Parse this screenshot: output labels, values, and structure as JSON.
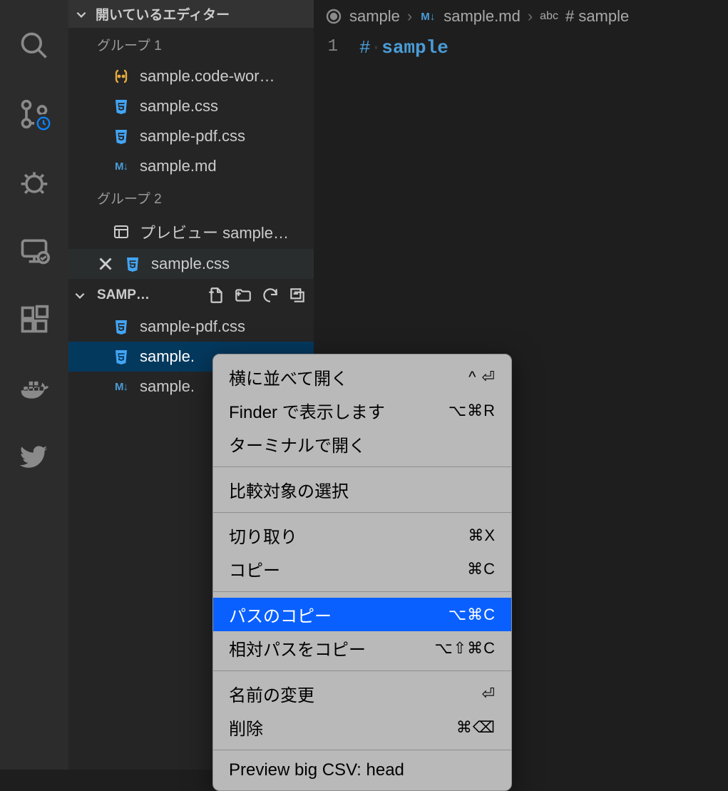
{
  "sidebar": {
    "open_editors_header": "開いているエディター",
    "groups": [
      {
        "label": "グループ 1",
        "items": [
          {
            "icon": "workspace",
            "label": "sample.code-wor…"
          },
          {
            "icon": "css",
            "label": "sample.css"
          },
          {
            "icon": "css",
            "label": "sample-pdf.css"
          },
          {
            "icon": "md",
            "label": "sample.md"
          }
        ]
      },
      {
        "label": "グループ 2",
        "items": [
          {
            "icon": "preview",
            "label": "プレビュー sample…"
          },
          {
            "icon": "css",
            "label": "sample.css",
            "dirty": true
          }
        ]
      }
    ],
    "folder_name": "SAMP…",
    "explorer_items": [
      {
        "icon": "css",
        "label": "sample-pdf.css"
      },
      {
        "icon": "css",
        "label": "sample."
      },
      {
        "icon": "md",
        "label": "sample."
      }
    ]
  },
  "breadcrumb": {
    "folder": "sample",
    "file": "sample.md",
    "symbol": "# sample"
  },
  "editor": {
    "line_number": "1",
    "hash": "#",
    "dot": "·",
    "title": "sample"
  },
  "context_menu": {
    "items": [
      {
        "label": "横に並べて開く",
        "shortcut": "^ ⏎"
      },
      {
        "label": "Finder で表示します",
        "shortcut": "⌥⌘R"
      },
      {
        "label": "ターミナルで開く",
        "shortcut": ""
      },
      {
        "sep": true
      },
      {
        "label": "比較対象の選択",
        "shortcut": ""
      },
      {
        "sep": true
      },
      {
        "label": "切り取り",
        "shortcut": "⌘X"
      },
      {
        "label": "コピー",
        "shortcut": "⌘C"
      },
      {
        "sep": true
      },
      {
        "label": "パスのコピー",
        "shortcut": "⌥⌘C",
        "highlight": true
      },
      {
        "label": "相対パスをコピー",
        "shortcut": "⌥⇧⌘C"
      },
      {
        "sep": true
      },
      {
        "label": "名前の変更",
        "shortcut": "⏎"
      },
      {
        "label": "削除",
        "shortcut": "⌘⌫"
      },
      {
        "sep": true
      },
      {
        "label": "Preview big CSV: head",
        "shortcut": ""
      }
    ]
  }
}
